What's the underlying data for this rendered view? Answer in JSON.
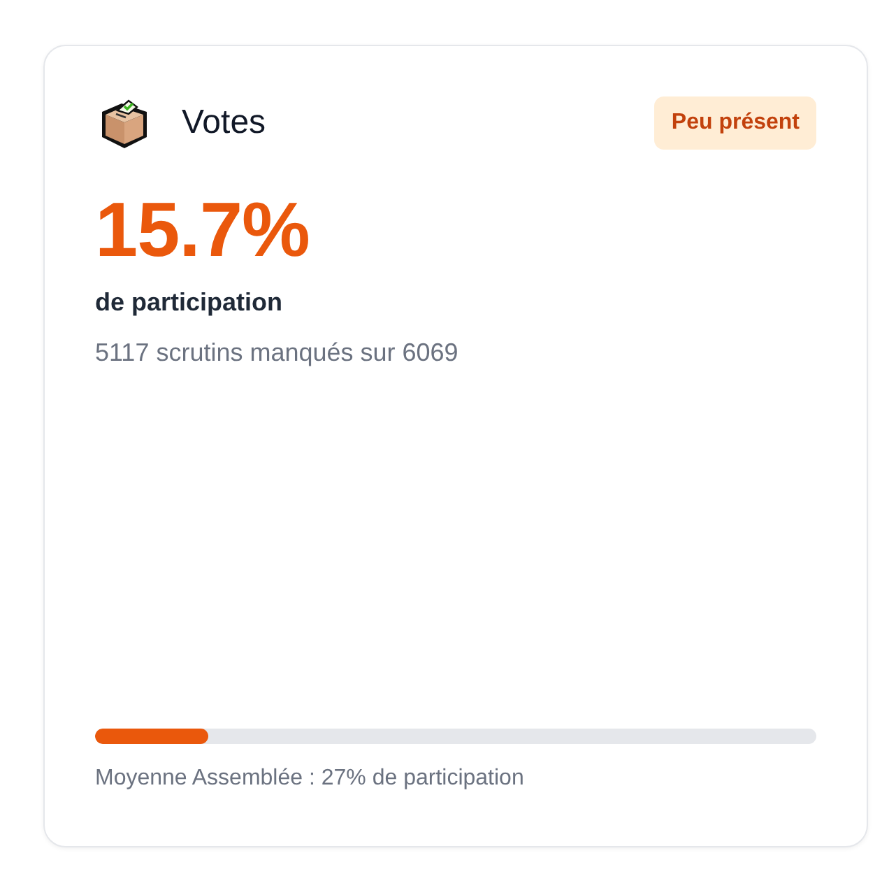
{
  "card": {
    "title": "Votes",
    "badge": {
      "label": "Peu présent",
      "kind": "warning"
    },
    "rate": "15.7%",
    "rate_label": "de participation",
    "detail": "5117 scrutins manqués sur 6069",
    "progress": {
      "level": 0.157
    },
    "caption": "Moyenne Assemblée : 27% de participation"
  }
}
